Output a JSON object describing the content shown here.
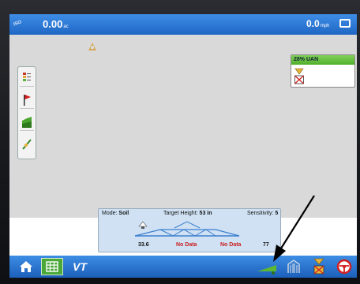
{
  "status_bar": {
    "logo_text": "ISO",
    "area_value": "0.00",
    "area_unit": "ac",
    "speed_value": "0.0",
    "speed_unit": "mph"
  },
  "product": {
    "label": "28% UAN"
  },
  "boom_panel": {
    "mode_label": "Mode:",
    "mode_value": "Soil",
    "target_label": "Target Height:",
    "target_value": "53 in",
    "sensitivity_label": "Sensitivity:",
    "sensitivity_value": "5",
    "readings": [
      "33.6",
      "No Data",
      "No Data",
      "77"
    ]
  },
  "colors": {
    "accent_blue": "#2a78d6",
    "map_gray": "#d9d9d9",
    "product_green": "#5cb833",
    "warning_red": "#d22020",
    "boom_blue": "#3b7fd0"
  },
  "icons": {
    "left_toolbar": [
      "legend-icon",
      "flag-icon",
      "field-icon",
      "guidance-icon"
    ],
    "bottom_bar": [
      "home-icon",
      "grid-icon",
      "vt-icon",
      "boom-height-icon",
      "gate-icon",
      "product-warning-icon",
      "steering-wheel-icon"
    ]
  }
}
